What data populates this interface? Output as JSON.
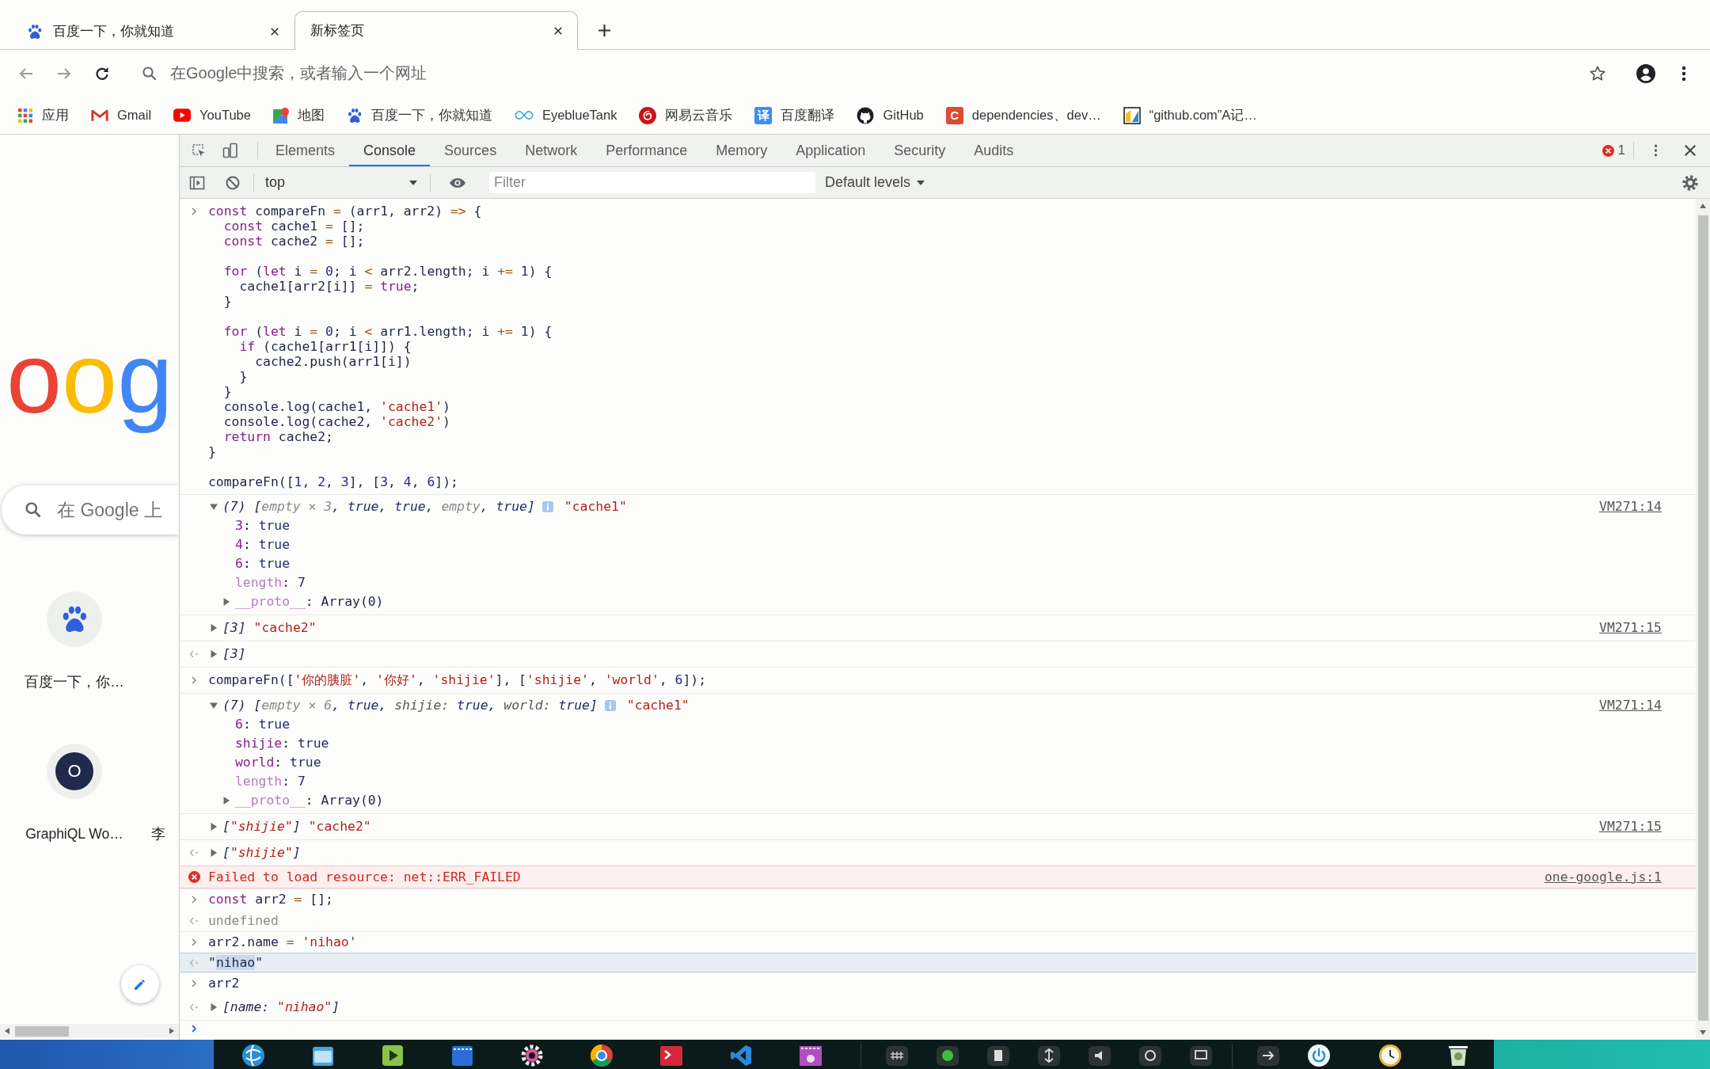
{
  "browser_tabs": [
    {
      "title": "百度一下，你就知道",
      "selected": false
    },
    {
      "title": "新标签页",
      "selected": true
    }
  ],
  "address_bar": {
    "placeholder": "在Google中搜索，或者输入一个网址"
  },
  "bookmarks": [
    {
      "label": "应用"
    },
    {
      "label": "Gmail"
    },
    {
      "label": "YouTube"
    },
    {
      "label": "地图"
    },
    {
      "label": "百度一下，你就知道"
    },
    {
      "label": "EyeblueTank"
    },
    {
      "label": "网易云音乐"
    },
    {
      "label": "百度翻译",
      "badge": "译",
      "color": "#3b8ef0"
    },
    {
      "label": "GitHub"
    },
    {
      "label": "dependencies、dev…",
      "badge": "C",
      "color": "#dd4b33"
    },
    {
      "label": "“github.com”A记…"
    }
  ],
  "new_tab_page": {
    "logo": "oog",
    "search_placeholder": "在 Google 上",
    "shortcuts": [
      {
        "title": "百度一下，你…",
        "kind": "favicon"
      },
      {
        "title": "GraphiQL Wo…",
        "kind": "letter",
        "initial": "O"
      },
      {
        "title": "李",
        "kind": "covered"
      }
    ]
  },
  "devtools": {
    "tabs": [
      {
        "label": "Elements",
        "selected": false
      },
      {
        "label": "Console",
        "selected": true
      },
      {
        "label": "Sources",
        "selected": false
      },
      {
        "label": "Network",
        "selected": false
      },
      {
        "label": "Performance",
        "selected": false
      },
      {
        "label": "Memory",
        "selected": false
      },
      {
        "label": "Application",
        "selected": false
      },
      {
        "label": "Security",
        "selected": false
      },
      {
        "label": "Audits",
        "selected": false
      }
    ],
    "error_count": "1",
    "context": "top",
    "filter_placeholder": "Filter",
    "levels": "Default levels"
  },
  "console": {
    "entries": [
      {
        "kind": "input",
        "selected": false,
        "segments": [
          {
            "kind": "kw",
            "text": "const"
          },
          {
            "kind": "plain",
            "text": " compareFn "
          },
          {
            "kind": "op",
            "text": "= "
          },
          {
            "kind": "plain",
            "text": "(arr1, arr2) "
          },
          {
            "kind": "op",
            "text": "=> "
          },
          {
            "kind": "plain",
            "text": "{\n  "
          },
          {
            "kind": "kw",
            "text": "const"
          },
          {
            "kind": "plain",
            "text": " cache1 "
          },
          {
            "kind": "op",
            "text": "= "
          },
          {
            "kind": "plain",
            "text": "[];\n  "
          },
          {
            "kind": "kw",
            "text": "const"
          },
          {
            "kind": "plain",
            "text": " cache2 "
          },
          {
            "kind": "op",
            "text": "= "
          },
          {
            "kind": "plain",
            "text": "[];\n\n  "
          },
          {
            "kind": "kw",
            "text": "for"
          },
          {
            "kind": "plain",
            "text": " ("
          },
          {
            "kind": "kw",
            "text": "let"
          },
          {
            "kind": "plain",
            "text": " i "
          },
          {
            "kind": "op",
            "text": "= "
          },
          {
            "kind": "num",
            "text": "0"
          },
          {
            "kind": "plain",
            "text": "; i "
          },
          {
            "kind": "op",
            "text": "< "
          },
          {
            "kind": "plain",
            "text": "arr2.length; i "
          },
          {
            "kind": "op",
            "text": "+= "
          },
          {
            "kind": "num",
            "text": "1"
          },
          {
            "kind": "plain",
            "text": ") {\n    cache1[arr2[i]] "
          },
          {
            "kind": "op",
            "text": "= "
          },
          {
            "kind": "kw",
            "text": "true"
          },
          {
            "kind": "plain",
            "text": ";\n  }\n\n  "
          },
          {
            "kind": "kw",
            "text": "for"
          },
          {
            "kind": "plain",
            "text": " ("
          },
          {
            "kind": "kw",
            "text": "let"
          },
          {
            "kind": "plain",
            "text": " i "
          },
          {
            "kind": "op",
            "text": "= "
          },
          {
            "kind": "num",
            "text": "0"
          },
          {
            "kind": "plain",
            "text": "; i "
          },
          {
            "kind": "op",
            "text": "< "
          },
          {
            "kind": "plain",
            "text": "arr1.length; i "
          },
          {
            "kind": "op",
            "text": "+= "
          },
          {
            "kind": "num",
            "text": "1"
          },
          {
            "kind": "plain",
            "text": ") {\n    "
          },
          {
            "kind": "kw",
            "text": "if"
          },
          {
            "kind": "plain",
            "text": " (cache1[arr1[i]]) {\n      cache2.push(arr1[i])\n    }\n  }\n  console.log(cache1, "
          },
          {
            "kind": "str",
            "text": "'cache1'"
          },
          {
            "kind": "plain",
            "text": ")\n  console.log(cache2, "
          },
          {
            "kind": "str",
            "text": "'cache2'"
          },
          {
            "kind": "plain",
            "text": ")\n  "
          },
          {
            "kind": "kw",
            "text": "return"
          },
          {
            "kind": "plain",
            "text": " cache2;\n}\n\ncompareFn(["
          },
          {
            "kind": "num",
            "text": "1"
          },
          {
            "kind": "plain",
            "text": ", "
          },
          {
            "kind": "num",
            "text": "2"
          },
          {
            "kind": "plain",
            "text": ", "
          },
          {
            "kind": "num",
            "text": "3"
          },
          {
            "kind": "plain",
            "text": "], ["
          },
          {
            "kind": "num",
            "text": "3"
          },
          {
            "kind": "plain",
            "text": ", "
          },
          {
            "kind": "num",
            "text": "4"
          },
          {
            "kind": "plain",
            "text": ", "
          },
          {
            "kind": "num",
            "text": "6"
          },
          {
            "kind": "plain",
            "text": "]);"
          }
        ]
      },
      {
        "kind": "log",
        "selected": false,
        "expanded": true,
        "segments": [
          {
            "kind": "plain",
            "text": "(7) ["
          },
          {
            "kind": "dim",
            "text": "empty × 3"
          },
          {
            "kind": "plain",
            "text": ", "
          },
          {
            "kind": "val",
            "text": "true"
          },
          {
            "kind": "plain",
            "text": ", "
          },
          {
            "kind": "val",
            "text": "true"
          },
          {
            "kind": "plain",
            "text": ", "
          },
          {
            "kind": "dim",
            "text": "empty"
          },
          {
            "kind": "plain",
            "text": ", "
          },
          {
            "kind": "val",
            "text": "true"
          },
          {
            "kind": "plain",
            "text": "]"
          }
        ],
        "label": "\"cache1\"",
        "source": "VM271:14",
        "properties": [
          {
            "kind": "value",
            "segments": [
              {
                "kind": "key",
                "text": "3"
              },
              {
                "kind": "plain",
                "text": ": "
              },
              {
                "kind": "val",
                "text": "true"
              }
            ]
          },
          {
            "kind": "value",
            "segments": [
              {
                "kind": "key",
                "text": "4"
              },
              {
                "kind": "plain",
                "text": ": "
              },
              {
                "kind": "val",
                "text": "true"
              }
            ]
          },
          {
            "kind": "value",
            "segments": [
              {
                "kind": "key",
                "text": "6"
              },
              {
                "kind": "plain",
                "text": ": "
              },
              {
                "kind": "val",
                "text": "true"
              }
            ]
          },
          {
            "kind": "value",
            "segments": [
              {
                "kind": "dimkey",
                "text": "length"
              },
              {
                "kind": "plain",
                "text": ": "
              },
              {
                "kind": "val",
                "text": "7"
              }
            ]
          },
          {
            "kind": "object",
            "segments": [
              {
                "kind": "dimkey",
                "text": "__proto__"
              },
              {
                "kind": "plain",
                "text": ": Array(0)"
              }
            ]
          }
        ]
      },
      {
        "kind": "log",
        "selected": false,
        "expanded": false,
        "segments": [
          {
            "kind": "plain",
            "text": "[3]"
          }
        ],
        "label": "\"cache2\"",
        "source": "VM271:15"
      },
      {
        "kind": "result",
        "selected": false,
        "expanded": false,
        "segments": [
          {
            "kind": "plain",
            "text": "[3]"
          }
        ]
      },
      {
        "kind": "input",
        "selected": false,
        "segments": [
          {
            "kind": "plain",
            "text": "compareFn(["
          },
          {
            "kind": "str",
            "text": "'你的胰脏'"
          },
          {
            "kind": "plain",
            "text": ", "
          },
          {
            "kind": "str",
            "text": "'你好'"
          },
          {
            "kind": "plain",
            "text": ", "
          },
          {
            "kind": "str",
            "text": "'shijie'"
          },
          {
            "kind": "plain",
            "text": "], ["
          },
          {
            "kind": "str",
            "text": "'shijie'"
          },
          {
            "kind": "plain",
            "text": ", "
          },
          {
            "kind": "str",
            "text": "'world'"
          },
          {
            "kind": "plain",
            "text": ", "
          },
          {
            "kind": "num",
            "text": "6"
          },
          {
            "kind": "plain",
            "text": "]);"
          }
        ]
      },
      {
        "kind": "log",
        "selected": false,
        "expanded": true,
        "segments": [
          {
            "kind": "plain",
            "text": "(7) ["
          },
          {
            "kind": "dim",
            "text": "empty × 6"
          },
          {
            "kind": "plain",
            "text": ", "
          },
          {
            "kind": "val",
            "text": "true"
          },
          {
            "kind": "plain",
            "text": ", "
          },
          {
            "kind": "pkey",
            "text": "shijie: "
          },
          {
            "kind": "val",
            "text": "true"
          },
          {
            "kind": "plain",
            "text": ", "
          },
          {
            "kind": "pkey",
            "text": "world: "
          },
          {
            "kind": "val",
            "text": "true"
          },
          {
            "kind": "plain",
            "text": "]"
          }
        ],
        "label": "\"cache1\"",
        "source": "VM271:14",
        "properties": [
          {
            "kind": "value",
            "segments": [
              {
                "kind": "key",
                "text": "6"
              },
              {
                "kind": "plain",
                "text": ": "
              },
              {
                "kind": "val",
                "text": "true"
              }
            ]
          },
          {
            "kind": "value",
            "segments": [
              {
                "kind": "key",
                "text": "shijie"
              },
              {
                "kind": "plain",
                "text": ": "
              },
              {
                "kind": "val",
                "text": "true"
              }
            ]
          },
          {
            "kind": "value",
            "segments": [
              {
                "kind": "key",
                "text": "world"
              },
              {
                "kind": "plain",
                "text": ": "
              },
              {
                "kind": "val",
                "text": "true"
              }
            ]
          },
          {
            "kind": "value",
            "segments": [
              {
                "kind": "dimkey",
                "text": "length"
              },
              {
                "kind": "plain",
                "text": ": "
              },
              {
                "kind": "val",
                "text": "7"
              }
            ]
          },
          {
            "kind": "object",
            "segments": [
              {
                "kind": "dimkey",
                "text": "__proto__"
              },
              {
                "kind": "plain",
                "text": ": Array(0)"
              }
            ]
          }
        ]
      },
      {
        "kind": "log",
        "selected": false,
        "expanded": false,
        "segments": [
          {
            "kind": "plain",
            "text": "["
          },
          {
            "kind": "str",
            "text": "\"shijie\""
          },
          {
            "kind": "plain",
            "text": "]"
          }
        ],
        "label": "\"cache2\"",
        "source": "VM271:15"
      },
      {
        "kind": "result",
        "selected": false,
        "expanded": false,
        "segments": [
          {
            "kind": "plain",
            "text": "["
          },
          {
            "kind": "str",
            "text": "\"shijie\""
          },
          {
            "kind": "plain",
            "text": "]"
          }
        ]
      },
      {
        "kind": "error",
        "selected": false,
        "segments": [
          {
            "kind": "plain",
            "text": "Failed to load resource: net::ERR_FAILED"
          }
        ],
        "source": "one-google.js:1"
      },
      {
        "kind": "input",
        "selected": false,
        "segments": [
          {
            "kind": "kw",
            "text": "const"
          },
          {
            "kind": "plain",
            "text": " arr2 "
          },
          {
            "kind": "op",
            "text": "= "
          },
          {
            "kind": "plain",
            "text": "[];"
          }
        ]
      },
      {
        "kind": "result",
        "selected": false,
        "segments": [
          {
            "kind": "dim",
            "text": "undefined"
          }
        ]
      },
      {
        "kind": "input",
        "selected": false,
        "segments": [
          {
            "kind": "plain",
            "text": "arr2.name "
          },
          {
            "kind": "op",
            "text": "= "
          },
          {
            "kind": "str",
            "text": "'nihao'"
          }
        ]
      },
      {
        "kind": "result",
        "selected": true,
        "segments": [
          {
            "kind": "plain",
            "text": "\""
          },
          {
            "kind": "hl",
            "text": "nihao"
          },
          {
            "kind": "plain",
            "text": "\""
          }
        ]
      },
      {
        "kind": "input",
        "selected": false,
        "segments": [
          {
            "kind": "plain",
            "text": "arr2"
          }
        ]
      },
      {
        "kind": "result",
        "selected": false,
        "expanded": false,
        "segments": [
          {
            "kind": "plain",
            "text": "[name: "
          },
          {
            "kind": "str",
            "text": "\"nihao\""
          },
          {
            "kind": "plain",
            "text": "]"
          }
        ]
      }
    ]
  }
}
